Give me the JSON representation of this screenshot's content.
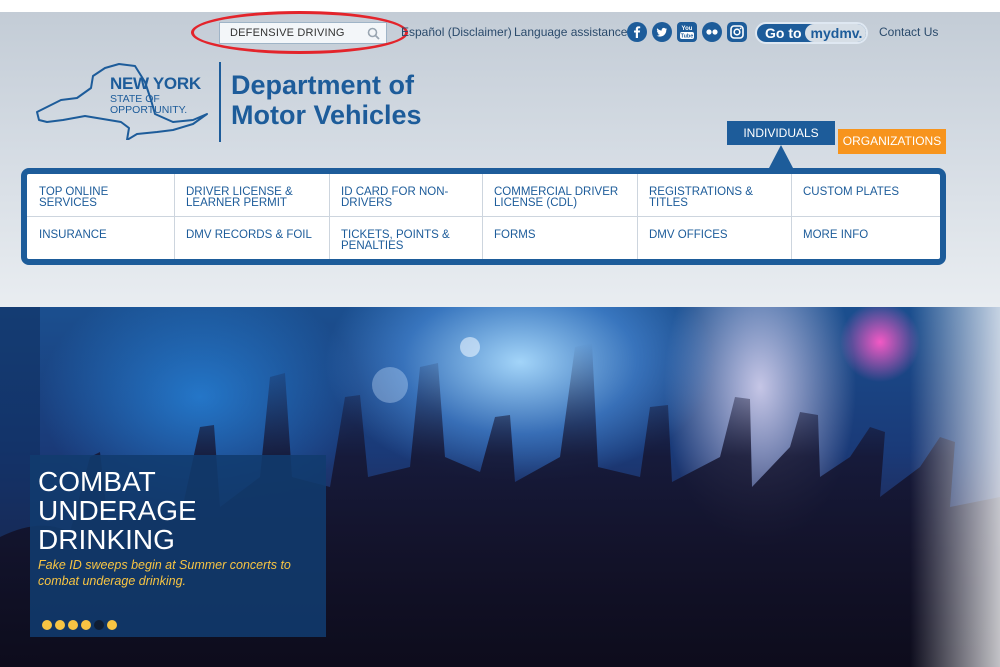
{
  "utility_bar": {
    "search": {
      "value": "DEFENSIVE DRIVING",
      "placeholder": ""
    },
    "espanol_link": "Español (Disclaimer)",
    "language_link": "Language assistance",
    "social_icons": [
      "facebook-icon",
      "twitter-icon",
      "youtube-icon",
      "flickr-icon",
      "instagram-icon"
    ],
    "mydmv": {
      "go_to": "Go to",
      "brand": "mydmv."
    },
    "contact_link": "Contact Us"
  },
  "logo": {
    "state_line1": "NEW YORK",
    "state_line2": "STATE OF",
    "state_line3": "OPPORTUNITY.",
    "dept_line1": "Department of",
    "dept_line2": "Motor Vehicles"
  },
  "audience_tabs": {
    "individuals": "INDIVIDUALS",
    "organizations": "ORGANIZATIONS"
  },
  "nav": {
    "row1": [
      "TOP ONLINE SERVICES",
      "DRIVER LICENSE & LEARNER PERMIT",
      "ID CARD FOR NON-DRIVERS",
      "COMMERCIAL DRIVER LICENSE (CDL)",
      "REGISTRATIONS & TITLES",
      "CUSTOM PLATES"
    ],
    "row2": [
      "INSURANCE",
      "DMV RECORDS & FOIL",
      "TICKETS, POINTS & PENALTIES",
      "FORMS",
      "DMV OFFICES",
      "MORE INFO"
    ]
  },
  "hero": {
    "title_line1": "COMBAT",
    "title_line2": "UNDERAGE",
    "title_line3": "DRINKING",
    "text": "Fake ID sweeps begin at Summer concerts to combat underage drinking.",
    "slide_count": 6,
    "active_slide": 5
  },
  "colors": {
    "brand_blue": "#1d5c9a",
    "accent_orange": "#f7941d",
    "highlight_red": "#e3242b",
    "hero_text_yellow": "#f7c443"
  }
}
